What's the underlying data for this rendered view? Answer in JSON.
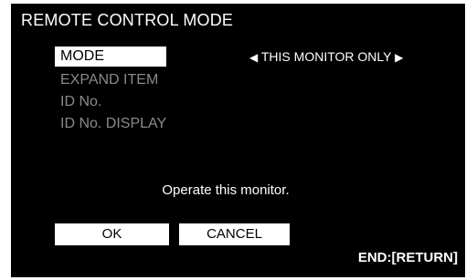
{
  "screen": {
    "title": "REMOTE CONTROL MODE"
  },
  "menu": {
    "items": [
      {
        "label": "MODE",
        "selected": true
      },
      {
        "label": "EXPAND ITEM",
        "selected": false
      },
      {
        "label": "ID No.",
        "selected": false
      },
      {
        "label": "ID No. DISPLAY",
        "selected": false
      }
    ]
  },
  "mode_setting": {
    "value": "THIS MONITOR ONLY",
    "left_arrow_icon": "triangle-left-icon",
    "right_arrow_icon": "triangle-right-icon"
  },
  "message": "Operate this monitor.",
  "buttons": {
    "ok_label": "OK",
    "cancel_label": "CANCEL"
  },
  "footer": {
    "end_hint": "END:[RETURN]"
  },
  "colors": {
    "background": "#000000",
    "text": "#ffffff",
    "disabled_text": "#8a8a8a",
    "highlight_bg": "#ffffff",
    "highlight_text": "#000000"
  }
}
